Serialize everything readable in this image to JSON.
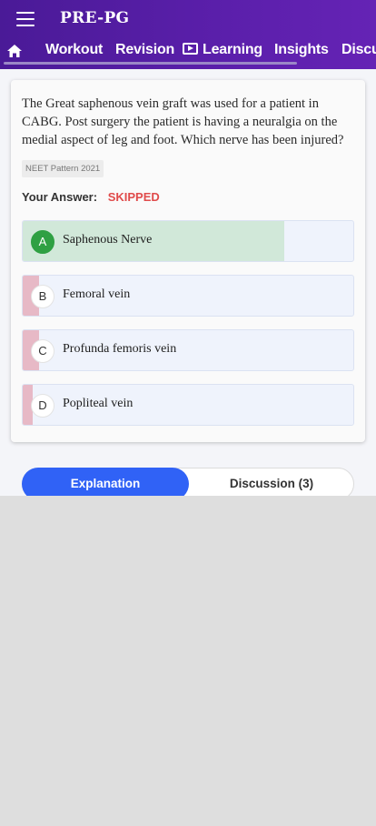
{
  "header": {
    "brand": "PRE-PG",
    "tabs": [
      {
        "label": "Workout"
      },
      {
        "label": "Revision"
      },
      {
        "label": "Learning"
      },
      {
        "label": "Insights"
      },
      {
        "label": "Discu"
      }
    ]
  },
  "question": {
    "text": "The Great saphenous vein graft was used for a patient in CABG. Post surgery the patient is having a neuralgia on the medial aspect of leg and foot. Which nerve has been injured?",
    "pattern": "NEET Pattern 2021",
    "answer_label": "Your Answer:",
    "answer_value": "SKIPPED"
  },
  "options": [
    {
      "letter": "A",
      "text": "Saphenous Nerve",
      "correct": true,
      "share_percent": 79
    },
    {
      "letter": "B",
      "text": "Femoral vein",
      "correct": false,
      "share_percent": 5
    },
    {
      "letter": "C",
      "text": "Profunda femoris vein",
      "correct": false,
      "share_percent": 5
    },
    {
      "letter": "D",
      "text": "Popliteal vein",
      "correct": false,
      "share_percent": 3
    }
  ],
  "bottom_tabs": {
    "explanation": "Explanation",
    "discussion": "Discussion (3)"
  },
  "colors": {
    "header": "#5b1fab",
    "correct": "#2fa043",
    "skipped": "#e04b4b",
    "active_tab": "#3062f6"
  }
}
